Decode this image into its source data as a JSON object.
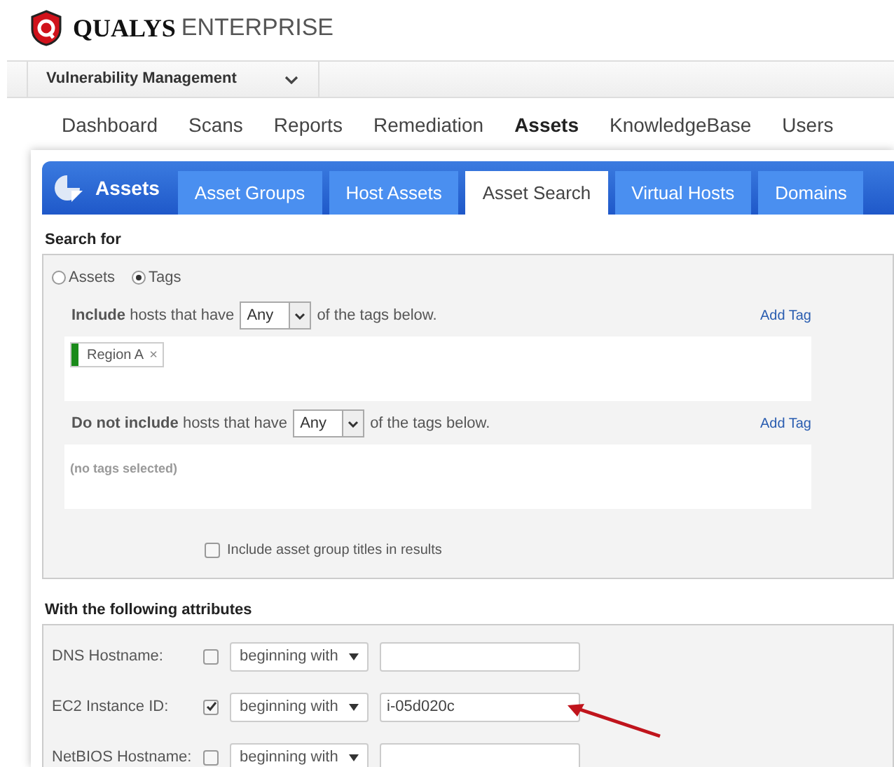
{
  "header": {
    "brand": "QUALYS",
    "edition": "ENTERPRISE"
  },
  "module": {
    "label": "Vulnerability Management"
  },
  "nav": [
    {
      "label": "Dashboard",
      "selected": false
    },
    {
      "label": "Scans",
      "selected": false
    },
    {
      "label": "Reports",
      "selected": false
    },
    {
      "label": "Remediation",
      "selected": false
    },
    {
      "label": "Assets",
      "selected": true
    },
    {
      "label": "KnowledgeBase",
      "selected": false
    },
    {
      "label": "Users",
      "selected": false
    }
  ],
  "section_title": "Assets",
  "tabs": [
    {
      "label": "Asset Groups",
      "selected": false
    },
    {
      "label": "Host Assets",
      "selected": false
    },
    {
      "label": "Asset Search",
      "selected": true
    },
    {
      "label": "Virtual Hosts",
      "selected": false
    },
    {
      "label": "Domains",
      "selected": false
    }
  ],
  "search_for": {
    "title": "Search for",
    "options": [
      {
        "label": "Assets",
        "selected": false
      },
      {
        "label": "Tags",
        "selected": true
      }
    ]
  },
  "include": {
    "before": "**Include** hosts that have",
    "select": "Any",
    "after": "of the tags below.",
    "add": "Add Tag",
    "tags": [
      {
        "label": "Region A",
        "remove": "×",
        "color": "#1a8a1a"
      }
    ]
  },
  "exclude": {
    "before": "**Do not include** hosts that have",
    "select": "Any",
    "after": "of the tags below.",
    "add": "Add Tag",
    "empty": "(no tags selected)"
  },
  "group_titles": {
    "label": "Include asset group titles in results",
    "checked": false
  },
  "attributes": {
    "title": "With the following attributes",
    "rows": [
      {
        "label": "DNS Hostname:",
        "checked": false,
        "operator": "beginning with",
        "value": ""
      },
      {
        "label": "EC2 Instance ID:",
        "checked": true,
        "operator": "beginning with",
        "value": "i-05d020c"
      },
      {
        "label": "NetBIOS Hostname:",
        "checked": false,
        "operator": "beginning with",
        "value": ""
      }
    ]
  }
}
